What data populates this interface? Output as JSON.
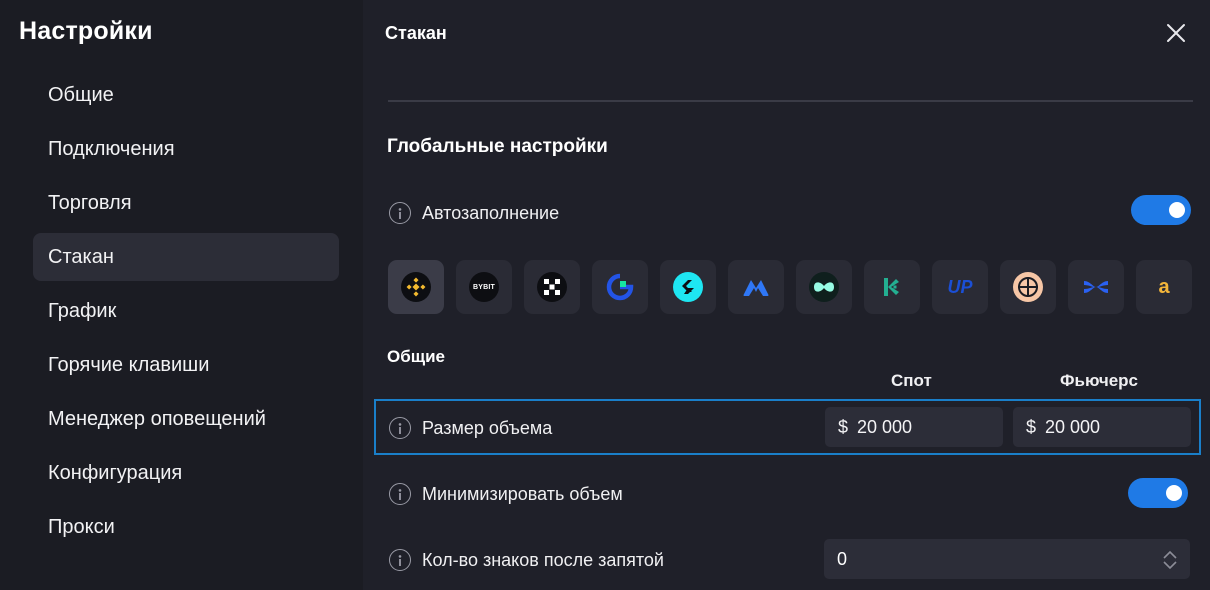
{
  "sidebar": {
    "title": "Настройки",
    "items": [
      {
        "label": "Общие"
      },
      {
        "label": "Подключения"
      },
      {
        "label": "Торговля"
      },
      {
        "label": "Стакан",
        "active": true
      },
      {
        "label": "График"
      },
      {
        "label": "Горячие клавиши"
      },
      {
        "label": "Менеджер оповещений"
      },
      {
        "label": "Конфигурация"
      },
      {
        "label": "Прокси"
      }
    ]
  },
  "panel": {
    "title": "Стакан",
    "global_section": "Глобальные настройки",
    "autofill": {
      "label": "Автозаполнение",
      "enabled": true
    },
    "exchanges": [
      {
        "icon": "binance-icon",
        "color": "#f3ba2f",
        "selected": true
      },
      {
        "icon": "bybit-icon",
        "logo_text": "BYBIT",
        "color": "#ffffff"
      },
      {
        "icon": "okx-icon",
        "color": "#ffffff"
      },
      {
        "icon": "gate-icon",
        "color": "#2354e6"
      },
      {
        "icon": "bitget-icon",
        "color": "#1ee6f2"
      },
      {
        "icon": "mexc-icon",
        "color": "#2f77f6"
      },
      {
        "icon": "hyperliquid-icon",
        "color": "#97fce4"
      },
      {
        "icon": "kucoin-icon",
        "color": "#23af91"
      },
      {
        "icon": "upbit-icon",
        "logo_text": "UP",
        "color": "#1b4fd6"
      },
      {
        "icon": "bingx-crosshair-icon",
        "color": "#f6c6a6"
      },
      {
        "icon": "bingx-icon",
        "color": "#2a61f2"
      },
      {
        "icon": "aster-icon",
        "logo_text": "a",
        "color": "#f2b53a"
      }
    ],
    "general_section": "Общие",
    "columns": {
      "spot": "Спот",
      "futures": "Фьючерс"
    },
    "volume_size": {
      "label": "Размер объема",
      "currency": "$",
      "spot_value": "20 000",
      "futures_value": "20 000"
    },
    "minimize_volume": {
      "label": "Минимизировать объем",
      "enabled": true
    },
    "decimals": {
      "label": "Кол-во знаков после запятой",
      "value": "0"
    }
  },
  "colors": {
    "accent": "#1f7ae6",
    "highlight_border": "#1a7fc9",
    "background": "#1f2029",
    "sidebar_bg": "#1b1c23"
  }
}
